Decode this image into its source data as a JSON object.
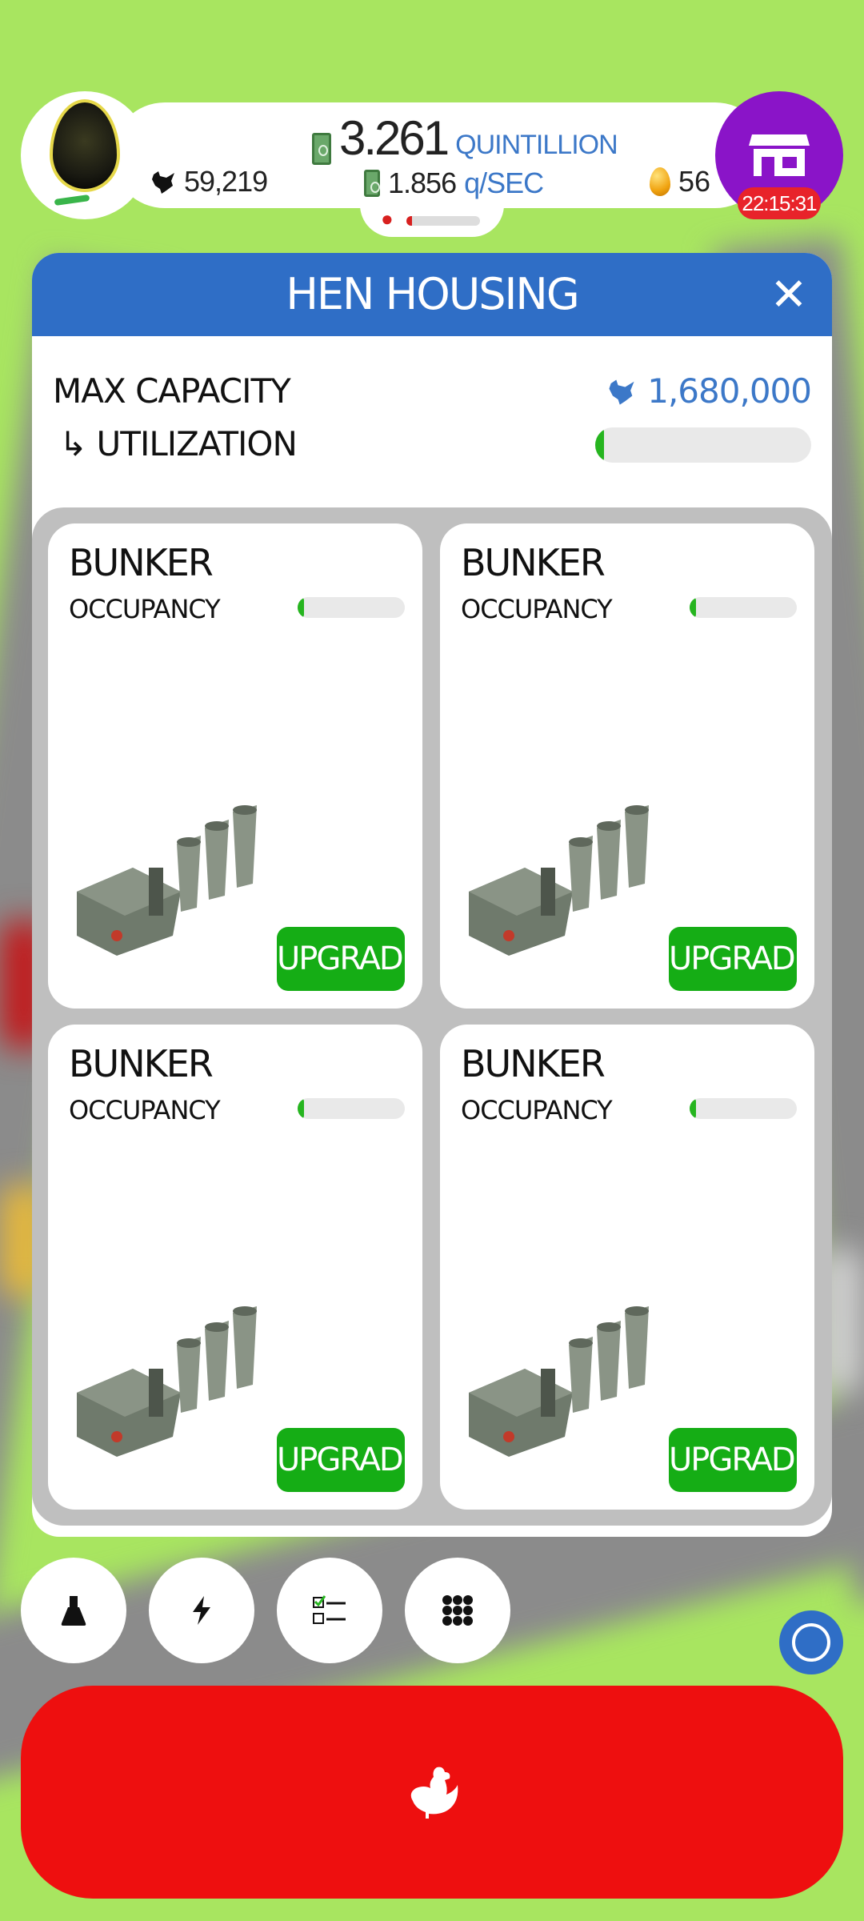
{
  "colors": {
    "background_green": "#a8e560",
    "header_blue": "#2f6ec6",
    "upgrade_green": "#15ad15",
    "hatch_red": "#ee0f0f",
    "shop_purple": "#8a14c8",
    "accent_blue_text": "#3c78c8"
  },
  "topbar": {
    "bank_value": "3.261",
    "bank_unit": "QUINTILLION",
    "earning_rate": "1.856",
    "earning_unit": "q/SEC",
    "chicken_count": "59,219",
    "golden_eggs": "56",
    "shop_timer": "22:15:31",
    "egg_icon": "current-egg-icon",
    "shop_icon": "shop-icon",
    "event_progress": 0.05,
    "egg_progress": 0.18
  },
  "panel": {
    "title": "HEN HOUSING",
    "close_icon": "close-icon",
    "max_capacity_label": "MAX CAPACITY",
    "max_capacity_value": "1,680,000",
    "utilization_label": "↳ UTILIZATION",
    "utilization_fraction": 0.035,
    "habs": [
      {
        "name": "BUNKER",
        "occupancy_label": "OCCUPANCY",
        "occupancy_fraction": 0.035,
        "button": "UPGRADE"
      },
      {
        "name": "BUNKER",
        "occupancy_label": "OCCUPANCY",
        "occupancy_fraction": 0.02,
        "button": "UPGRADE"
      },
      {
        "name": "BUNKER",
        "occupancy_label": "OCCUPANCY",
        "occupancy_fraction": 0.02,
        "button": "UPGRADE"
      },
      {
        "name": "BUNKER",
        "occupancy_label": "OCCUPANCY",
        "occupancy_fraction": 0.02,
        "button": "UPGRADE"
      }
    ]
  },
  "bottom": {
    "buttons": [
      "research-flask-icon",
      "boost-bolt-icon",
      "missions-checklist-icon",
      "menu-grid-icon"
    ],
    "hatch_icon": "chicken-icon"
  }
}
